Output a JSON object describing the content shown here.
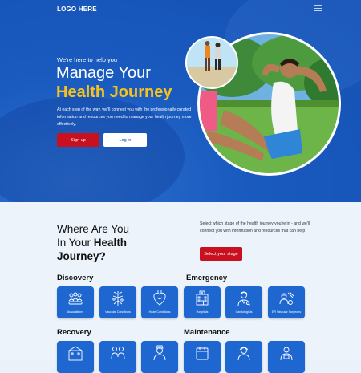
{
  "header": {
    "logo": "LOGO HERE",
    "menu_icon": "hamburger-icon"
  },
  "hero": {
    "tagline": "We're here to help you",
    "title_line1": "Manage Your",
    "title_line2": "Health Journey",
    "description": "At each step of the way, we'll connect you with the professionally curated information and resources you need to manage your health journey more effectively.",
    "signup_label": "Sign up",
    "login_label": "Log in",
    "accent_color": "#f7c21d",
    "primary_color": "#1a5bc0",
    "button_color": "#c8101e"
  },
  "journey": {
    "heading_part1": "Where  Are You",
    "heading_part2": "In Your ",
    "heading_highlight": "Health",
    "heading_part3": "Journey?",
    "description": "Select which stage of the health journey you're in - and we'll connect you with information and resources that can help",
    "select_stage_label": "Select your stage"
  },
  "categories": {
    "discovery": {
      "title": "Discovery",
      "items": [
        {
          "label": "Associations",
          "icon": "people-group-icon"
        },
        {
          "label": "Vascular Conditions",
          "icon": "vascular-icon"
        },
        {
          "label": "Heart Conditions",
          "icon": "heart-icon"
        }
      ]
    },
    "emergency": {
      "title": "Emergency",
      "items": [
        {
          "label": "Hospitals",
          "icon": "hospital-icon"
        },
        {
          "label": "Cardiologists",
          "icon": "doctor-icon"
        },
        {
          "label": "ER Vascular Surgeons",
          "icon": "surgeon-icon"
        }
      ]
    },
    "recovery": {
      "title": "Recovery",
      "items": [
        {
          "label": "",
          "icon": "clinic-building-icon"
        },
        {
          "label": "",
          "icon": "caregiver-icon"
        },
        {
          "label": "",
          "icon": "nurse-icon"
        }
      ]
    },
    "maintenance": {
      "title": "Maintenance",
      "items": [
        {
          "label": "",
          "icon": "calendar-icon"
        },
        {
          "label": "",
          "icon": "consultant-icon"
        },
        {
          "label": "",
          "icon": "support-person-icon"
        }
      ]
    }
  }
}
